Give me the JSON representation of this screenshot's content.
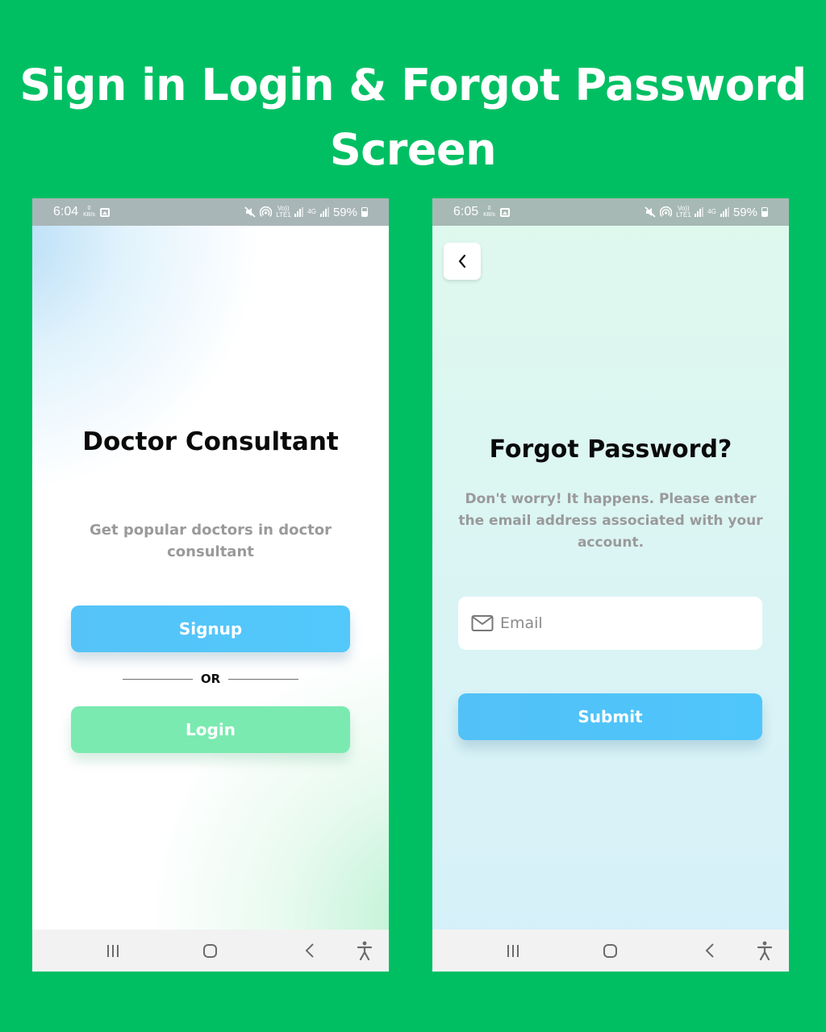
{
  "banner": {
    "line1": "Sign in Login & Forgot Password",
    "line2": "Screen"
  },
  "left_phone": {
    "status_bar": {
      "time": "6:04",
      "speed_value": "0",
      "speed_unit": "KB/s",
      "volte": "Vo)) LTE1",
      "network": "4G",
      "battery": "59%"
    },
    "app_title": "Doctor Consultant",
    "subtitle": "Get popular doctors in doctor consultant",
    "signup_label": "Signup",
    "or_label": "OR",
    "login_label": "Login"
  },
  "right_phone": {
    "status_bar": {
      "time": "6:05",
      "speed_value": "0",
      "speed_unit": "KB/s",
      "volte": "Vo)) LTE1",
      "network": "4G",
      "battery": "59%"
    },
    "title": "Forgot Password?",
    "description": "Don't worry! It happens. Please enter the email address associated with your account.",
    "email_placeholder": "Email",
    "submit_label": "Submit"
  },
  "colors": {
    "background": "#00bf63",
    "primary_button": "#52c3f8",
    "login_button": "#7aeab0"
  }
}
